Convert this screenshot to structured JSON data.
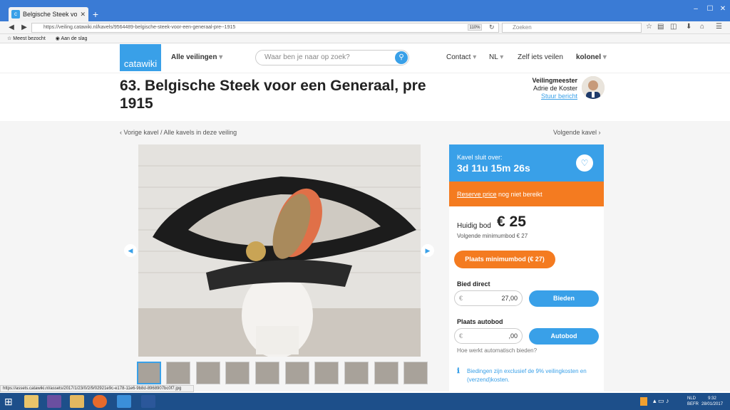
{
  "browser": {
    "tab_title": "Belgische Steek voor een ...",
    "url": "https://veiling.catawiki.nl/kavels/9564489-belgische-steek-voor-een-generaal-pre--1915",
    "zoom": "110%",
    "search_placeholder": "Zoeken",
    "bookmarks": [
      "Meest bezocht",
      "Aan de slag"
    ],
    "status_url": "https://assets.catawiki.nl/assets/2017/1/23/0/2/9/02921e9c-e178-11e6-9b8d-8968907bc0f7.jpg"
  },
  "header": {
    "logo": "catawiki",
    "all_auctions": "Alle veilingen",
    "search_placeholder": "Waar ben je naar op zoek?",
    "contact": "Contact",
    "lang": "NL",
    "sell": "Zelf iets veilen",
    "user": "kolonel"
  },
  "lot": {
    "title": "63. Belgische Steek voor een Generaal, pre 1915",
    "auctioneer_label": "Veilingmeester",
    "auctioneer_name": "Adrie de Koster",
    "send_message": "Stuur bericht",
    "prev": "‹ Vorige kavel",
    "sep": " / ",
    "all_lots": "Alle kavels in deze veiling",
    "next": "Volgende kavel ›"
  },
  "bid": {
    "closes_label": "Kavel sluit over:",
    "countdown": "3d 11u 15m 26s",
    "reserve_link": "Reserve price",
    "reserve_rest": " nog niet bereikt",
    "current_label": "Huidig bod",
    "current_value": "€ 25",
    "min_next": "Volgende minimumbod € 27",
    "min_btn": "Plaats minimumbod (€ 27)",
    "direct_label": "Bied direct",
    "direct_cur": "€",
    "direct_value": "27,00",
    "direct_btn": "Bieden",
    "auto_label": "Plaats autobod",
    "auto_cur": "€",
    "auto_value": ",00",
    "auto_btn": "Autobod",
    "howto": "Hoe werkt automatisch bieden?",
    "notice": "Biedingen zijn exclusief de 9% veilingkosten en (verzend)kosten."
  },
  "taskbar": {
    "lang1": "NLD",
    "lang2": "BEFR",
    "time": "9:32",
    "date": "28/01/2017"
  },
  "colors": {
    "accent": "#39a0e8",
    "orange": "#f47b20",
    "browser_frame": "#3a7bd5"
  }
}
